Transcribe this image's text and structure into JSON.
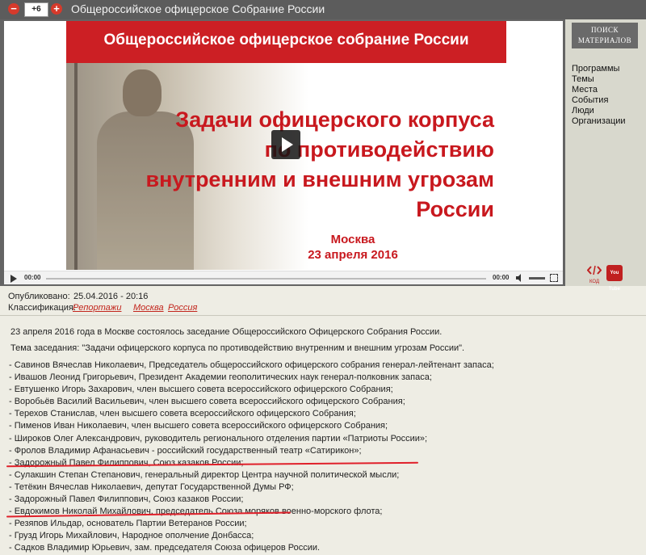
{
  "titlebar": {
    "minus_glyph": "−",
    "count": "+6",
    "plus_glyph": "+",
    "title": "Общероссийское офицерское Собрание России"
  },
  "video": {
    "slide_header": "Общероссийское офицерское собрание России",
    "slide_title_lines": [
      "Задачи офицерского корпуса",
      "по противодействию",
      "внутренним и внешним угрозам",
      "России"
    ],
    "slide_city": "Москва",
    "slide_date": "23 апреля 2016",
    "current_time": "00:00",
    "duration": "00:00",
    "progress": 0
  },
  "sidebar": {
    "search_label_line1": "ПОИСК",
    "search_label_line2": "МАТЕРИАЛОВ",
    "links": [
      "Программы",
      "Темы",
      "Места",
      "События",
      "Люди",
      "Организации"
    ],
    "code_label": "КОД",
    "youtube_label": "You Tube"
  },
  "meta": {
    "published_label": "Опубликовано:",
    "published_value": "25.04.2016 - 20:16",
    "class_label": "Классификация:",
    "tags": [
      "Репортажи",
      "Москва",
      "Россия"
    ]
  },
  "article": {
    "intro": "23 апреля 2016 года в Москве состоялось заседание Общероссийского Офицерского Собрания России.",
    "topic": "Тема заседания: \"Задачи офицерского корпуса по противодействию внутренним и внешним угрозам России\".",
    "participants": [
      "- Савинов Вячеслав Николаевич, Председатель общероссийского офицерского собрания  генерал-лейтенант запаса;",
      "- Ивашов Леонид Григорьевич, Президент Академии геополитических наук генерал-полковник запаса;",
      "- Евтушенко Игорь Захарович, член высшего совета всероссийского офицерского Собрания;",
      "- Воробьёв Василий Васильевич, член высшего совета всероссийского офицерского Собрания;",
      "- Терехов Станислав, член высшего совета всероссийского офицерского Собрания;",
      "- Пименов Иван Николаевич, член высшего совета всероссийского офицерского Собрания;",
      "- Широков Олег Александрович, руководитель регионального отделения партии «Патриоты России»;",
      "- Фролов Владимир Афанасьевич - российский государственный театр «Сатирикон»;",
      "- Задорожный Павел Филиппович, Союз казаков России;",
      "- Сулакшин Степан Степанович, генеральный директор Центра научной политической мысли;",
      "- Тетёкин Вячеслав Николаевич, депутат Государственной Думы  РФ;",
      "- Задорожный Павел Филиппович, Союз казаков России;",
      "- Евдокимов Николай Михайлович, председатель Союза моряков военно-морского флота;",
      "- Резяпов Ильдар, основатель Партии Ветеранов России;",
      "- Грузд Игорь Михайлович, Народное ополчение Донбасса;",
      "- Садков Владимир Юрьевич, зам. председателя Союза офицеров России."
    ]
  },
  "colors": {
    "accent_red": "#c8181e",
    "titlebar_bg": "#5c5c5c",
    "page_bg": "#eeede4",
    "link_red": "#c2251c",
    "underline_red": "#e0202a"
  }
}
